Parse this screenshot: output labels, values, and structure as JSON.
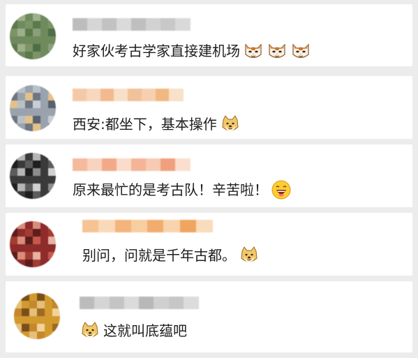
{
  "comments": [
    {
      "text": "好家伙考古学家直接建机场",
      "emojis": [
        "cat-face-emoji",
        "cat-face-emoji",
        "cat-face-emoji"
      ],
      "name_colors": [
        "#bdbdbd",
        "#d6d6d6",
        "#c2c2c2",
        "#dadada",
        "#bfbfbf",
        "#d2d2d2",
        "#c8c8c8",
        "#d9d9d9"
      ],
      "avatar_colors": [
        "#6f8b5d",
        "#8ba07a",
        "#5a7a4c",
        "#9db08a",
        "#7c9466",
        "#4e6e46"
      ]
    },
    {
      "text": "西安:都坐下，基本操作",
      "emojis": [
        "doge-emoji"
      ],
      "name_colors": [
        "#f4c9a8",
        "#f7d7bd",
        "#f3b98f",
        "#f8dfc8",
        "#f1c19a",
        "#f6d0b0",
        "#f2b882",
        "#f9e0c9"
      ],
      "avatar_colors": [
        "#9aa3ad",
        "#c9ced4",
        "#6d7681",
        "#b8c0c8",
        "#e4c18a",
        "#58616c"
      ]
    },
    {
      "text": "原来最忙的是考古队！辛苦啦！",
      "emojis": [
        "laughing-face-emoji"
      ],
      "name_colors": [
        "#f5b99c",
        "#f8d3c0",
        "#f2a98a",
        "#f9dccb",
        "#f4b496",
        "#f7cab3",
        "#f0a07e",
        "#fadfd0"
      ],
      "avatar_colors": [
        "#3a3a3a",
        "#8d8d8d",
        "#1f1f1f",
        "#b5b5b5",
        "#5c5c5c",
        "#d0d0d0"
      ]
    },
    {
      "text": "别问，问就是千年古都。",
      "emojis": [
        "doge-emoji"
      ],
      "name_colors": [
        "#f6c393",
        "#f9d9b9",
        "#f3b57c",
        "#f7ce9f",
        "#f2ac6d",
        "#f8d4ae",
        "#f0a55e",
        "#f9dcbb"
      ],
      "avatar_colors": [
        "#8e2b2b",
        "#c65a4a",
        "#5e1c1c",
        "#d98d7a",
        "#a33c32",
        "#e7b3a2"
      ]
    },
    {
      "text": "这就叫底蕴吧",
      "emojis": [
        "doge-emoji"
      ],
      "emoji_first": true,
      "name_colors": [
        "#bcbcbc",
        "#d5d5d5",
        "#c4c4c4",
        "#dbdbdb",
        "#b8b8b8",
        "#d0d0d0",
        "#c6c6c6",
        "#dcdcdc"
      ],
      "avatar_colors": [
        "#d29a2e",
        "#9c6a22",
        "#e6c07a",
        "#7a4e1a",
        "#c4872a",
        "#f0d39a"
      ]
    }
  ]
}
